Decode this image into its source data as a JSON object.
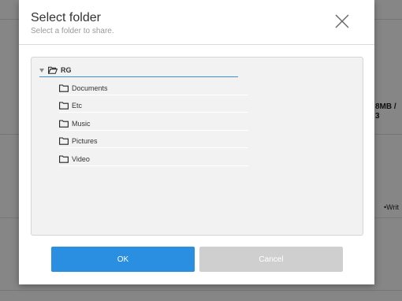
{
  "background": {
    "size_text": "8MB /",
    "size_text2": "3",
    "write_text": "•Writ"
  },
  "dialog": {
    "title": "Select folder",
    "subtitle": "Select a folder to share.",
    "close_icon": "close-icon",
    "tree": {
      "root": {
        "label": "RG",
        "icon": "folder-open-icon",
        "expanded": true
      },
      "children": [
        {
          "label": "Documents",
          "icon": "folder-icon"
        },
        {
          "label": "Etc",
          "icon": "folder-icon"
        },
        {
          "label": "Music",
          "icon": "folder-icon"
        },
        {
          "label": "Pictures",
          "icon": "folder-icon"
        },
        {
          "label": "Video",
          "icon": "folder-icon"
        }
      ]
    },
    "ok_label": "OK",
    "cancel_label": "Cancel"
  },
  "colors": {
    "accent": "#2a8fe0",
    "cancel": "#cfcfcf"
  }
}
